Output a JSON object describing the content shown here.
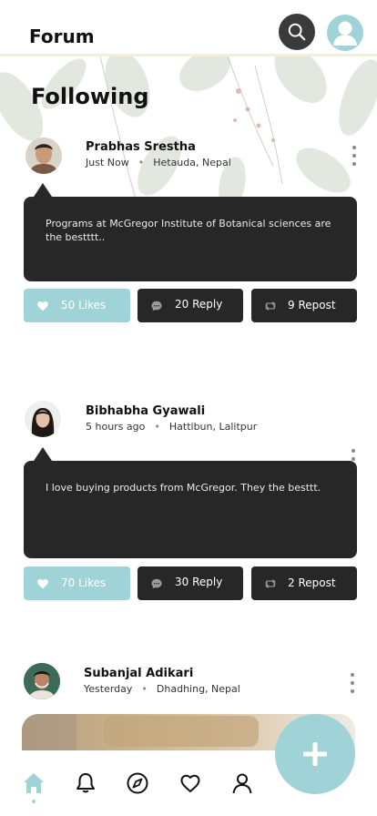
{
  "header": {
    "title": "Forum",
    "search_icon": "search-icon",
    "profile_icon": "user-avatar-icon"
  },
  "section_title": "Following",
  "posts": [
    {
      "author": "Prabhas Srestha",
      "time": "Just Now",
      "location": "Hetauda, Nepal",
      "text": "Programs at McGregor Institute of Botanical sciences are the bestttt..",
      "likes": "50 Likes",
      "replies": "20 Reply",
      "reposts": "9 Repost"
    },
    {
      "author": "Bibhabha Gyawali",
      "time": "5 hours ago",
      "location": "Hattibun, Lalitpur",
      "text": "I love buying products from McGregor. They the besttt.",
      "likes": "70 Likes",
      "replies": "30 Reply",
      "reposts": "2 Repost"
    },
    {
      "author": "Subanjal Adikari",
      "time": "Yesterday",
      "location": "Dhadhing, Nepal"
    }
  ],
  "bottom_nav": [
    "home-icon",
    "bell-icon",
    "compass-icon",
    "heart-icon",
    "user-icon"
  ],
  "colors": {
    "accent": "#9fd3d8",
    "dark": "#272727",
    "header_rule": "#f5efd9"
  }
}
